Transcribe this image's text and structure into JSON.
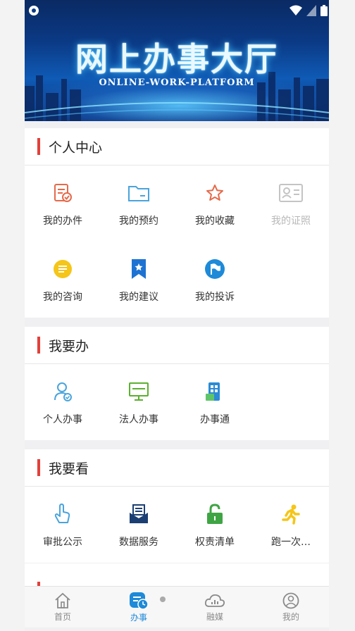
{
  "banner": {
    "title": "网上办事大厅",
    "subtitle": "ONLINE-WORK-PLATFORM"
  },
  "sections": {
    "personal": {
      "title": "个人中心",
      "items": [
        "我的办件",
        "我的预约",
        "我的收藏",
        "我的证照",
        "我的咨询",
        "我的建议",
        "我的投诉"
      ]
    },
    "todo": {
      "title": "我要办",
      "items": [
        "个人办事",
        "法人办事",
        "办事通"
      ]
    },
    "view": {
      "title": "我要看",
      "items": [
        "审批公示",
        "数据服务",
        "权责清单",
        "跑一次…"
      ]
    }
  },
  "tabs": [
    "首页",
    "办事",
    "融媒",
    "我的"
  ],
  "colors": {
    "accent_red": "#e2403a",
    "accent_blue": "#1e8ad8"
  }
}
